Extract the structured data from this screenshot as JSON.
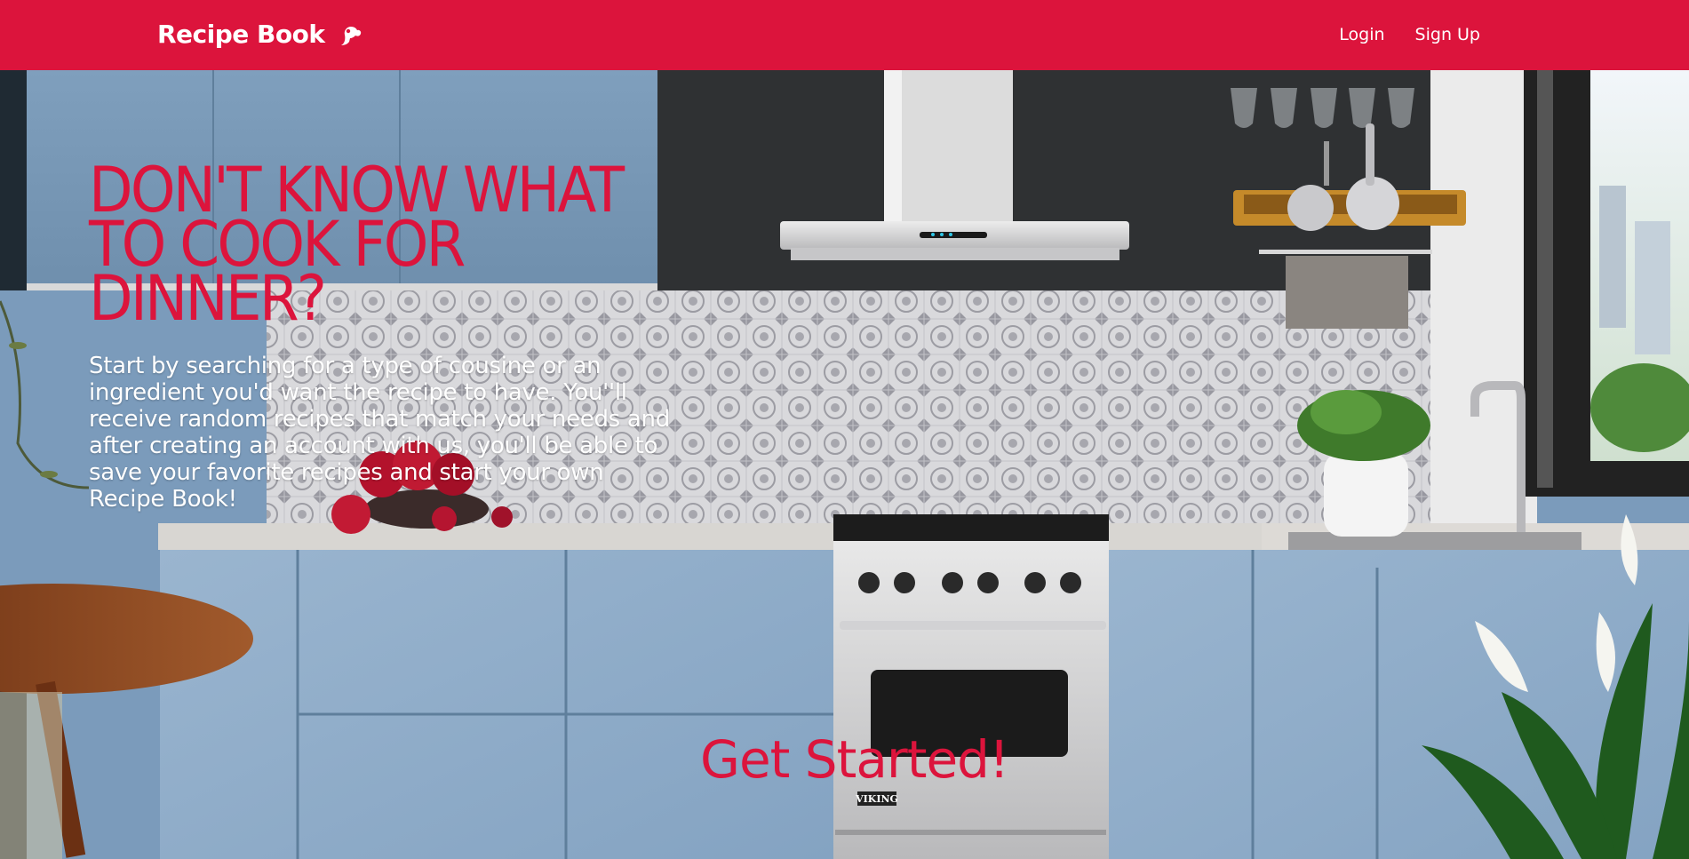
{
  "navbar": {
    "brand": "Recipe Book",
    "brand_icon": "chef-hat-icon",
    "links": [
      "Login",
      "Sign Up"
    ]
  },
  "hero": {
    "title": "DON'T KNOW WHAT TO COOK FOR DINNER?",
    "description": "Start by searching for a type of cousine or an ingredient you'd want the recipe to have. You''ll receive random recipes that match your needs and after creating an account with us, you'll be able to save your favorite recipes and start your own Recipe Book!",
    "cta": "Get Started!",
    "background": "kitchen-photo",
    "oven_brand": "VIKING"
  },
  "colors": {
    "accent": "#dc143c",
    "text_light": "#ffffff"
  }
}
